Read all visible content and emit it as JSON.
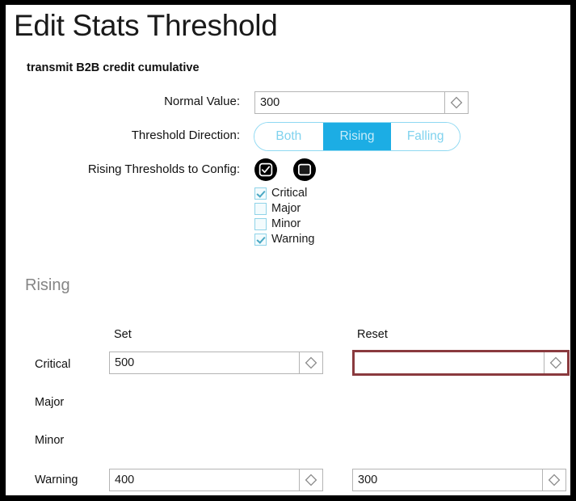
{
  "window": {
    "title": "Edit Stats Threshold",
    "subtitle": "transmit B2B credit cumulative"
  },
  "colors": {
    "accent": "#1cade4",
    "accent_light": "#8fd9f2",
    "error_border": "#8a3a3e",
    "checkbox_border": "#8fd3e8",
    "checkbox_check": "#4aa8c4",
    "section_heading": "#858585",
    "frame": "#000000"
  },
  "form": {
    "normal_value": {
      "label": "Normal Value:",
      "value": "300",
      "stepper_icon": "spinner-diamond-icon"
    },
    "threshold_direction": {
      "label": "Threshold Direction:",
      "options": [
        "Both",
        "Rising",
        "Falling"
      ],
      "selected": "Rising"
    },
    "rising_thresholds_to_config": {
      "label": "Rising Thresholds to Config:",
      "buttons": [
        {
          "name": "check-all",
          "icon": "check-square-circle-icon"
        },
        {
          "name": "clear-all",
          "icon": "filled-square-circle-icon"
        }
      ],
      "severities": [
        {
          "label": "Critical",
          "checked": true
        },
        {
          "label": "Major",
          "checked": false
        },
        {
          "label": "Minor",
          "checked": false
        },
        {
          "label": "Warning",
          "checked": true
        }
      ]
    }
  },
  "rising_section": {
    "heading": "Rising",
    "columns": {
      "set": "Set",
      "reset": "Reset"
    },
    "rows": [
      {
        "label": "Critical",
        "set": "500",
        "reset": "",
        "reset_error": true
      },
      {
        "label": "Major",
        "set": null,
        "reset": null,
        "reset_error": false
      },
      {
        "label": "Minor",
        "set": null,
        "reset": null,
        "reset_error": false
      },
      {
        "label": "Warning",
        "set": "400",
        "reset": "300",
        "reset_error": false
      }
    ]
  }
}
